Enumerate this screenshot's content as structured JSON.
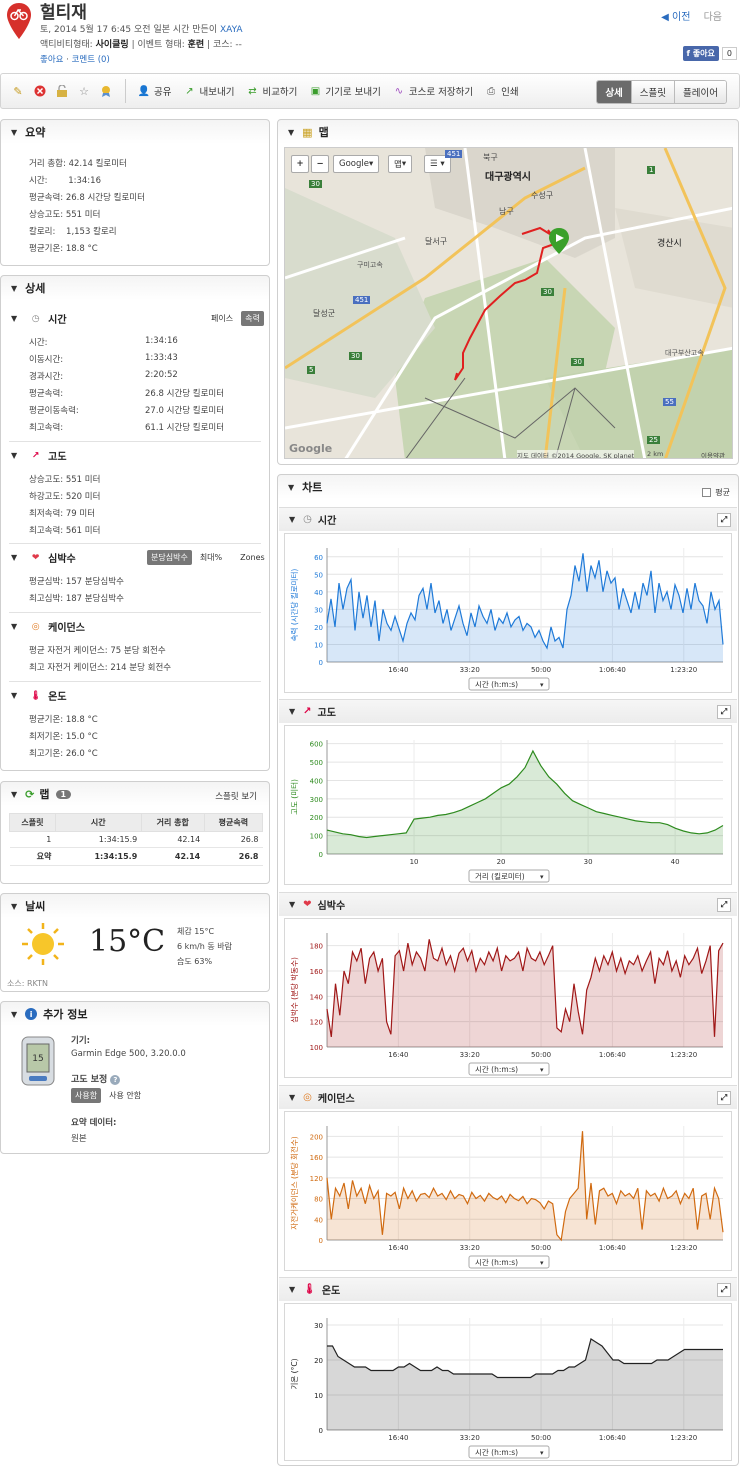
{
  "header": {
    "title": "헐티재",
    "meta_line1": "토, 2014 5월 17 6:45 오전 일본 시간 만든이 ",
    "author": "XAYA",
    "activity_label": "액티비티형태: ",
    "activity_value": "사이클링",
    "event_label": " | 이벤트 형태: ",
    "event_value": "훈련",
    "course_label": " | 코스: --",
    "like_link": "좋아요",
    "comment_link": "코멘트 (0)",
    "prev": "이전",
    "next": "다음",
    "fb_like": "좋아요",
    "fb_count": "0"
  },
  "toolbar": {
    "share": "공유",
    "export": "내보내기",
    "compare": "비교하기",
    "send_device": "기기로 보내기",
    "save_course": "코스로 저장하기",
    "print": "인쇄",
    "tabs": [
      "상세",
      "스플릿",
      "플레이어"
    ]
  },
  "summary": {
    "title": "요약",
    "rows": [
      {
        "label": "거리 총합:",
        "value": "42.14 킬로미터"
      },
      {
        "label": "시간:",
        "value": "1:34:16"
      },
      {
        "label": "평균속력:",
        "value": "26.8 시간당 킬로미터"
      },
      {
        "label": "상승고도:",
        "value": "551 미터"
      },
      {
        "label": "칼로리:",
        "value": "1,153 칼로리"
      },
      {
        "label": "평균기온:",
        "value": "18.8 °C"
      }
    ]
  },
  "details": {
    "title": "상세",
    "time": {
      "title": "시간",
      "toggle": [
        "페이스",
        "속력"
      ],
      "rows": [
        {
          "label": "시간:",
          "value": "1:34:16"
        },
        {
          "label": "이동시간:",
          "value": "1:33:43"
        },
        {
          "label": "경과시간:",
          "value": "2:20:52"
        },
        {
          "label": "평균속력:",
          "value": "26.8 시간당 킬로미터"
        },
        {
          "label": "평균이동속력:",
          "value": "27.0 시간당 킬로미터"
        },
        {
          "label": "최고속력:",
          "value": "61.1 시간당 킬로미터"
        }
      ]
    },
    "elevation": {
      "title": "고도",
      "rows": [
        {
          "label": "상승고도:",
          "value": "551 미터"
        },
        {
          "label": "하강고도:",
          "value": "520 미터"
        },
        {
          "label": "최저속력:",
          "value": "79 미터"
        },
        {
          "label": "최고속력:",
          "value": "561 미터"
        }
      ]
    },
    "heart": {
      "title": "심박수",
      "toggle": [
        "분당심박수",
        "최대%",
        "Zones"
      ],
      "rows": [
        {
          "label": "평균심박:",
          "value": "157 분당심박수"
        },
        {
          "label": "최고심박:",
          "value": "187 분당심박수"
        }
      ]
    },
    "cadence": {
      "title": "케이던스",
      "rows": [
        {
          "label": "평균 자전거 케이던스:",
          "value": "75 분당 회전수"
        },
        {
          "label": "최고 자전거 케이던스:",
          "value": "214 분당 회전수"
        }
      ]
    },
    "temp": {
      "title": "온도",
      "rows": [
        {
          "label": "평균기온:",
          "value": "18.8 °C"
        },
        {
          "label": "최저기온:",
          "value": "15.0 °C"
        },
        {
          "label": "최고기온:",
          "value": "26.0 °C"
        }
      ]
    }
  },
  "laps": {
    "title": "랩",
    "count": "1",
    "split_link": "스플릿 보기",
    "headers": [
      "스플릿",
      "시간",
      "거리 총합",
      "평균속력"
    ],
    "row": [
      "1",
      "1:34:15.9",
      "42.14",
      "26.8"
    ],
    "summary_row": [
      "요약",
      "1:34:15.9",
      "42.14",
      "26.8"
    ]
  },
  "weather": {
    "title": "날씨",
    "temp": "15°C",
    "feels": "체감 15°C",
    "wind": "6 km/h 동 바람",
    "humidity": "습도 63%",
    "source": "소스: RKTN"
  },
  "extra": {
    "title": "추가 정보",
    "device_label": "기기:",
    "device_value": "Garmin Edge 500, 3.20.0.0",
    "elev_corr_label": "고도 보정",
    "elev_corr_on": "사용함",
    "elev_corr_off": "사용 안함",
    "summary_data_label": "요약 데이터:",
    "summary_data_value": "원본",
    "device_screen": "15"
  },
  "map": {
    "title": "맵",
    "google_btn": "Google",
    "map_btn": "맵",
    "labels": [
      "북구",
      "대구광역시",
      "수성구",
      "남구",
      "달서구",
      "달성군",
      "경산시",
      "구미고속",
      "대구부산고속"
    ],
    "road_numbers": [
      "451",
      "30",
      "1",
      "30",
      "451",
      "5",
      "30",
      "55",
      "25",
      "30"
    ],
    "copyright": "지도 데이터 ©2014 Google, SK planet",
    "scale": "2 km",
    "terms": "이용약관",
    "logo": "Google"
  },
  "charts": {
    "title": "차트",
    "avg_label": "평균",
    "colors": {
      "speed": "#1f7ad8",
      "elev": "#2e8b1f",
      "hr": "#a01818",
      "cad": "#d06a10",
      "temp": "#222222"
    }
  },
  "chart_data": [
    {
      "type": "area",
      "title": "시간",
      "ylabel": "속력 (시간당 킬로미터)",
      "xlabel": "시간 (h:m:s)",
      "x_ticks": [
        "16:40",
        "33:20",
        "50:00",
        "1:06:40",
        "1:23:20"
      ],
      "y_ticks": [
        0,
        10,
        20,
        30,
        40,
        50,
        60
      ],
      "ylim": [
        0,
        65
      ],
      "values": [
        22,
        36,
        20,
        45,
        30,
        42,
        47,
        18,
        40,
        25,
        38,
        20,
        35,
        12,
        30,
        22,
        18,
        26,
        19,
        12,
        22,
        28,
        24,
        38,
        42,
        30,
        45,
        28,
        35,
        22,
        30,
        18,
        25,
        32,
        22,
        15,
        28,
        20,
        32,
        26,
        22,
        30,
        18,
        25,
        22,
        28,
        20,
        24,
        26,
        18,
        22,
        20,
        14,
        18,
        12,
        8,
        20,
        12,
        14,
        8,
        30,
        38,
        55,
        46,
        62,
        40,
        55,
        48,
        58,
        40,
        52,
        45,
        48,
        30,
        42,
        35,
        28,
        40,
        30,
        45,
        38,
        52,
        28,
        45,
        35,
        40,
        30,
        44,
        38,
        28,
        42,
        30,
        45,
        35,
        32,
        22,
        40,
        30,
        35,
        10
      ]
    },
    {
      "type": "area",
      "title": "고도",
      "ylabel": "고도 (미터)",
      "xlabel": "거리 (킬로미터)",
      "x_ticks": [
        "10",
        "20",
        "30",
        "40"
      ],
      "y_ticks": [
        0,
        100,
        200,
        300,
        400,
        500,
        600
      ],
      "ylim": [
        0,
        620
      ],
      "values": [
        130,
        120,
        110,
        105,
        95,
        90,
        95,
        100,
        105,
        110,
        115,
        190,
        195,
        200,
        210,
        215,
        225,
        240,
        260,
        280,
        300,
        330,
        360,
        380,
        420,
        470,
        560,
        480,
        420,
        380,
        330,
        290,
        270,
        250,
        230,
        220,
        210,
        200,
        190,
        180,
        175,
        170,
        170,
        160,
        140,
        125,
        115,
        110,
        115,
        130,
        155
      ]
    },
    {
      "type": "area",
      "title": "심박수",
      "ylabel": "심박수 (분당 박동수)",
      "xlabel": "시간 (h:m:s)",
      "x_ticks": [
        "16:40",
        "33:20",
        "50:00",
        "1:06:40",
        "1:23:20"
      ],
      "y_ticks": [
        100,
        120,
        140,
        160,
        180
      ],
      "ylim": [
        100,
        190
      ],
      "values": [
        130,
        108,
        150,
        125,
        160,
        150,
        175,
        168,
        178,
        150,
        170,
        175,
        160,
        170,
        120,
        110,
        172,
        176,
        160,
        182,
        165,
        175,
        170,
        160,
        185,
        170,
        168,
        178,
        165,
        172,
        160,
        174,
        178,
        168,
        176,
        160,
        170,
        165,
        175,
        168,
        178,
        160,
        172,
        168,
        170,
        175,
        160,
        178,
        170,
        168,
        175,
        165,
        172,
        180,
        115,
        112,
        130,
        120,
        150,
        128,
        110,
        145,
        155,
        170,
        160,
        172,
        165,
        175,
        160,
        170,
        158,
        168,
        165,
        172,
        160,
        168,
        175,
        150,
        170,
        165,
        176,
        160,
        168,
        155,
        172,
        165,
        170,
        178,
        158,
        168,
        180,
        108,
        176,
        182
      ]
    },
    {
      "type": "area",
      "title": "케이던스",
      "ylabel": "자전거케이던스 (분당 회전수)",
      "xlabel": "시간 (h:m:s)",
      "x_ticks": [
        "16:40",
        "33:20",
        "50:00",
        "1:06:40",
        "1:23:20"
      ],
      "y_ticks": [
        0,
        40,
        80,
        120,
        160,
        200
      ],
      "ylim": [
        0,
        220
      ],
      "values": [
        120,
        40,
        100,
        85,
        110,
        60,
        115,
        85,
        100,
        70,
        105,
        80,
        95,
        10,
        90,
        85,
        92,
        60,
        100,
        80,
        95,
        75,
        88,
        90,
        82,
        100,
        85,
        90,
        78,
        95,
        80,
        88,
        85,
        70,
        92,
        80,
        86,
        75,
        90,
        82,
        78,
        85,
        72,
        88,
        80,
        76,
        84,
        70,
        80,
        78,
        72,
        60,
        75,
        70,
        10,
        0,
        55,
        80,
        90,
        100,
        210,
        40,
        110,
        30,
        95,
        100,
        85,
        90,
        70,
        95,
        85,
        90,
        80,
        100,
        20,
        95,
        85,
        90,
        75,
        100,
        80,
        85,
        95,
        70,
        90,
        80,
        100,
        20,
        85,
        90,
        40,
        100,
        80,
        15
      ]
    },
    {
      "type": "area",
      "title": "온도",
      "ylabel": "기온 (°C)",
      "xlabel": "시간 (h:m:s)",
      "x_ticks": [
        "16:40",
        "33:20",
        "50:00",
        "1:06:40",
        "1:23:20"
      ],
      "y_ticks": [
        0,
        10,
        20,
        30
      ],
      "ylim": [
        0,
        32
      ],
      "values": [
        24,
        24,
        21,
        20,
        19,
        18,
        18,
        18,
        17,
        17,
        17,
        17,
        17,
        18,
        18,
        19,
        18,
        17,
        17,
        17,
        18,
        17,
        17,
        16,
        16,
        16,
        16,
        16,
        16,
        16,
        16,
        15,
        15,
        15,
        15,
        15,
        15,
        15,
        16,
        16,
        16,
        16,
        17,
        17,
        18,
        18,
        19,
        20,
        26,
        25,
        24,
        22,
        20,
        20,
        19,
        19,
        19,
        19,
        19,
        19,
        20,
        20,
        20,
        21,
        22,
        23,
        23,
        23,
        23,
        23,
        23,
        23,
        23
      ]
    }
  ]
}
